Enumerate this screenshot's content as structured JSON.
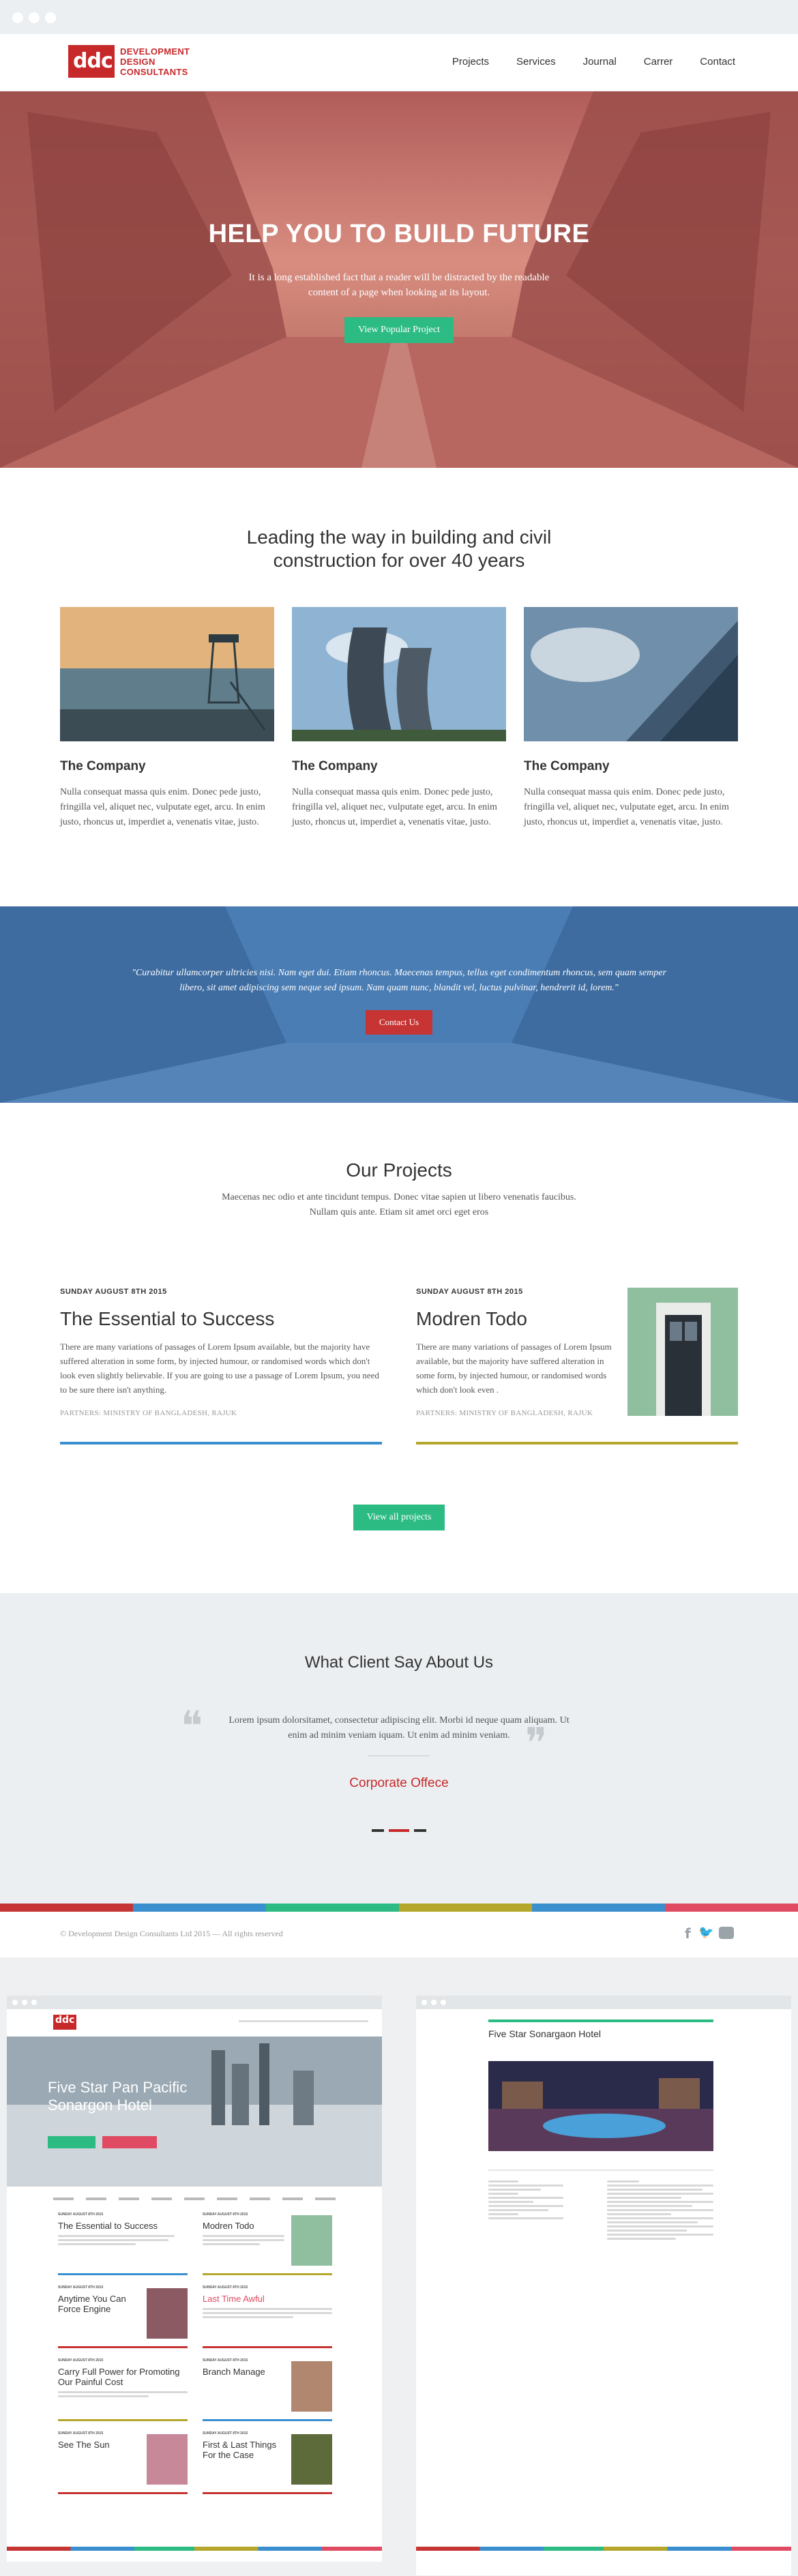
{
  "header": {
    "logo_text": "ddc",
    "brand_line1": "DEVELOPMENT",
    "brand_line2": "DESIGN",
    "brand_line3": "CONSULTANTS",
    "menu": [
      {
        "label": "Projects"
      },
      {
        "label": "Services"
      },
      {
        "label": "Journal"
      },
      {
        "label": "Carrer"
      },
      {
        "label": "Contact"
      }
    ]
  },
  "hero": {
    "title": "HELP YOU TO BUILD FUTURE",
    "subtitle": "It is a long established fact that a reader will be distracted by the readable content of a page when looking at its layout.",
    "button": "View Popular Project"
  },
  "intro": {
    "heading": "Leading the way in building and civil construction for over 40 years",
    "cards": [
      {
        "title": "The Company",
        "text": "Nulla consequat massa quis enim. Donec pede justo, fringilla vel, aliquet nec, vulputate eget, arcu. In enim justo, rhoncus ut, imperdiet a, venenatis vitae, justo."
      },
      {
        "title": "The Company",
        "text": "Nulla consequat massa quis enim. Donec pede justo, fringilla vel, aliquet nec, vulputate eget, arcu. In enim justo, rhoncus ut, imperdiet a, venenatis vitae, justo."
      },
      {
        "title": "The Company",
        "text": "Nulla consequat massa quis enim. Donec pede justo, fringilla vel, aliquet nec, vulputate eget, arcu. In enim justo, rhoncus ut, imperdiet a, venenatis vitae, justo."
      }
    ]
  },
  "quote": {
    "text": "\"Curabitur ullamcorper ultricies nisi. Nam eget dui. Etiam rhoncus. Maecenas tempus, tellus eget condimentum rhoncus, sem quam semper libero, sit amet adipiscing sem neque sed ipsum. Nam quam nunc, blandit vel, luctus pulvinar, hendrerit id, lorem.\"",
    "button": "Contact Us"
  },
  "projects": {
    "title": "Our Projects",
    "subtitle": "Maecenas nec odio et ante tincidunt tempus. Donec vitae sapien ut libero venenatis faucibus. Nullam quis ante. Etiam sit amet orci eget eros",
    "items": [
      {
        "date": "SUNDAY AUGUST 8TH 2015",
        "title": "The Essential to Success",
        "text": "There are many variations of passages of Lorem Ipsum available, but the majority have suffered alteration in some form, by injected humour, or randomised words which don't look even slightly believable. If you are going to use a passage of Lorem Ipsum, you need to be sure there isn't anything.",
        "partners": "PARTNERS: MINISTRY OF BANGLADESH, RAJUK"
      },
      {
        "date": "SUNDAY AUGUST 8TH 2015",
        "title": "Modren Todo",
        "text": "There are many variations of passages of Lorem Ipsum available, but the majority have suffered alteration in some form, by injected humour, or randomised words which don't look even .",
        "partners": "PARTNERS: MINISTRY OF BANGLADESH, RAJUK"
      }
    ],
    "view_all": "View all projects"
  },
  "testimonial": {
    "title": "What Client Say About Us",
    "text": "Lorem ipsum dolorsitamet, consectetur adipiscing elit. Morbi id neque quam aliquam. Ut enim ad minim veniam iquam. Ut enim ad minim veniam.",
    "author": "Corporate Offece"
  },
  "footer": {
    "copyright": "© Development Design Consultants Ltd 2015 — All rights reserved"
  },
  "preview_left": {
    "logo_text": "ddc",
    "hero_title": "Five Star Pan Pacific Sonargon Hotel",
    "cards": [
      {
        "title": "The Essential to Success"
      },
      {
        "title": "Modren Todo"
      },
      {
        "title": "Anytime You Can Force Engine"
      },
      {
        "title": "Last Time Awful"
      },
      {
        "title": "Carry Full Power for Promoting Our Painful Cost"
      },
      {
        "title": "Branch Manage"
      },
      {
        "title": "See The Sun"
      },
      {
        "title": "First & Last Things For the Case"
      }
    ]
  },
  "preview_right": {
    "title": "Five Star Sonargaon Hotel"
  },
  "colors": {
    "brand_red": "#c7292b",
    "accent_green": "#2dbb84",
    "stripe": [
      "#c73434",
      "#3a8fcf",
      "#2dbb84",
      "#b4a72b",
      "#3a8fcf",
      "#e04a62"
    ]
  }
}
